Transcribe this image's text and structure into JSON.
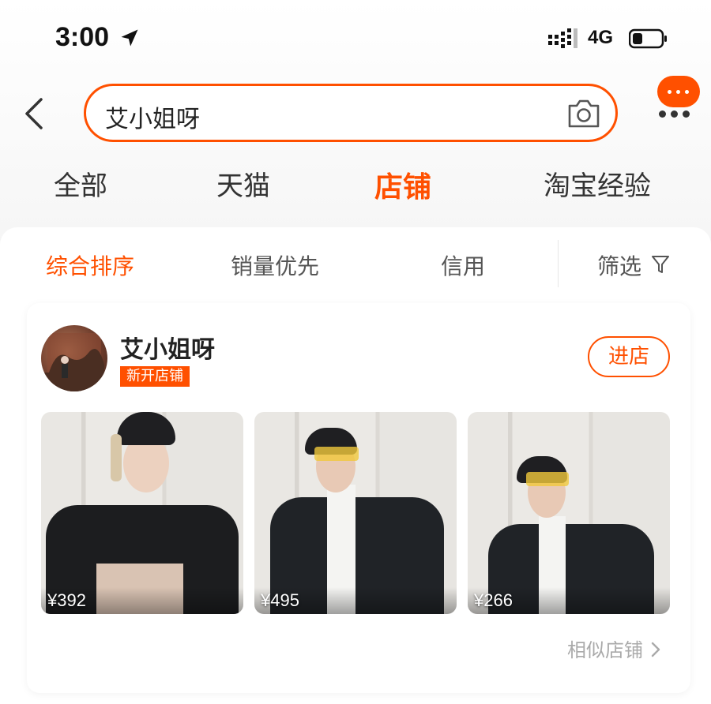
{
  "status_bar": {
    "time": "3:00",
    "network": "4G"
  },
  "search": {
    "query": "艾小姐呀"
  },
  "main_tabs": [
    {
      "label": "全部",
      "active": false
    },
    {
      "label": "天猫",
      "active": false
    },
    {
      "label": "店铺",
      "active": true
    },
    {
      "label": "淘宝经验",
      "active": false
    }
  ],
  "sort_tabs": [
    {
      "label": "综合排序",
      "active": true
    },
    {
      "label": "销量优先",
      "active": false
    },
    {
      "label": "信用",
      "active": false
    },
    {
      "label": "筛选",
      "active": false
    }
  ],
  "shop": {
    "name": "艾小姐呀",
    "badge": "新开店铺",
    "enter_label": "进店",
    "products": [
      {
        "price": "¥392"
      },
      {
        "price": "¥495"
      },
      {
        "price": "¥266"
      }
    ],
    "similar_label": "相似店铺"
  },
  "colors": {
    "accent": "#ff5000",
    "text": "#333333",
    "muted": "#aaaaaa"
  },
  "icons": [
    "location-arrow-icon",
    "signal-icon",
    "battery-icon",
    "back-icon",
    "camera-icon",
    "more-icon",
    "filter-icon",
    "chevron-right-icon"
  ]
}
